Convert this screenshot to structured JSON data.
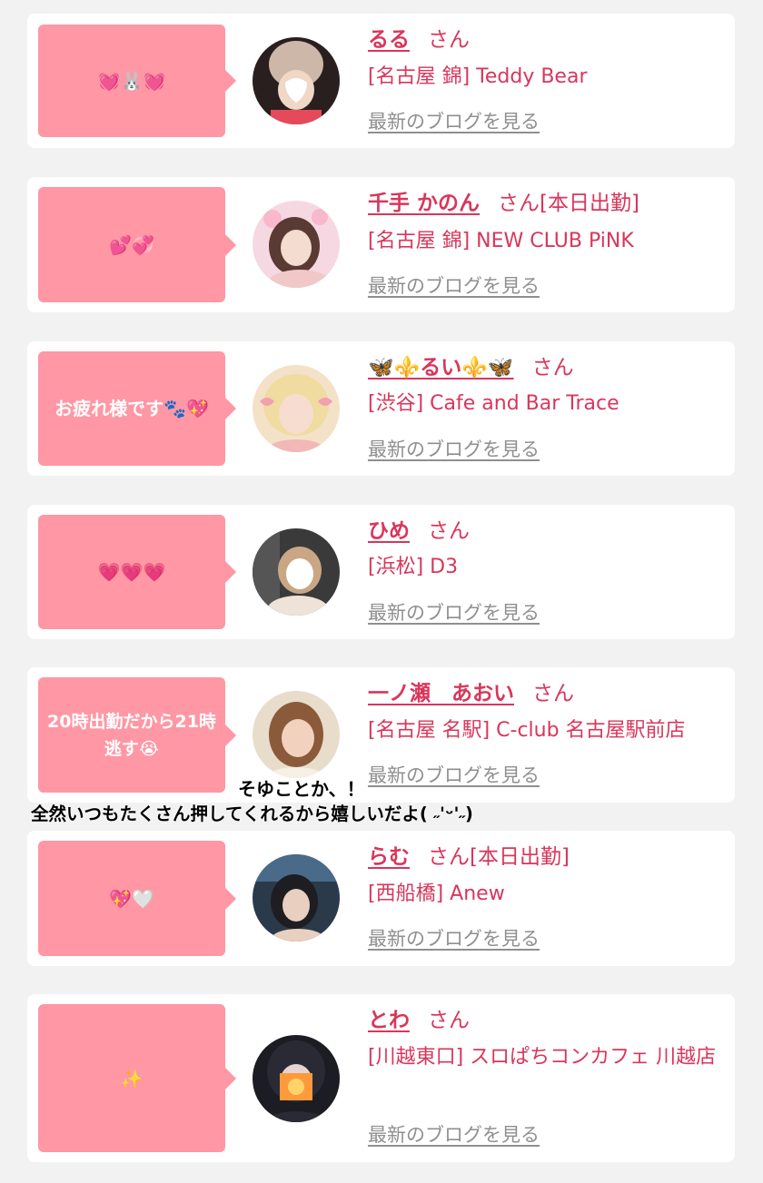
{
  "cards": [
    {
      "message": "💓🐰💓",
      "name": "るる",
      "honorific": "さん",
      "status": "",
      "shop": "[名古屋 錦] Teddy Bear",
      "blog_link": "最新のブログを見る",
      "avatar_colors": [
        "#e8d7c8",
        "#2a1f1f",
        "#d9a48a"
      ]
    },
    {
      "message": "💕💞",
      "name": "千手 かのん",
      "honorific": "さん",
      "status": "[本日出勤]",
      "shop": "[名古屋 錦] NEW CLUB PiNK",
      "blog_link": "最新のブログを見る",
      "avatar_colors": [
        "#f6d8e2",
        "#5a3a33",
        "#f0c8c8"
      ]
    },
    {
      "message": "お疲れ様です🐾💖",
      "name": "🦋⚜️るい⚜️🦋",
      "honorific": "さん",
      "status": "",
      "shop": "[渋谷] Cafe and Bar Trace",
      "blog_link": "最新のブログを見る",
      "avatar_colors": [
        "#f3e2c8",
        "#f0dba0",
        "#f2b8b8"
      ]
    },
    {
      "message": "💗💗💗",
      "name": "ひめ",
      "honorific": "さん",
      "status": "",
      "shop": "[浜松] D3",
      "blog_link": "最新のブログを見る",
      "avatar_colors": [
        "#3a3a3a",
        "#efe3d9",
        "#c9a784"
      ]
    },
    {
      "message": "20時出勤だから21時逃す😭",
      "name": "一ノ瀬　あおい",
      "honorific": "さん",
      "status": "",
      "shop": "[名古屋 名駅] C-club 名古屋駅前店",
      "blog_link": "最新のブログを見る",
      "avatar_colors": [
        "#e8dccb",
        "#8a5a3a",
        "#f2d2bf"
      ]
    },
    {
      "message": "💖🤍",
      "name": "らむ",
      "honorific": "さん",
      "status": "[本日出勤]",
      "shop": "[西船橋] Anew",
      "blog_link": "最新のブログを見る",
      "avatar_colors": [
        "#2a3a4a",
        "#1e1e22",
        "#e9cfc0"
      ]
    },
    {
      "message": "✨",
      "name": "とわ",
      "honorific": "さん",
      "status": "",
      "shop": "[川越東口] スロぱちコンカフェ 川越店",
      "blog_link": "最新のブログを見る",
      "avatar_colors": [
        "#1c1c24",
        "#ff9a3a",
        "#e6d4d0"
      ]
    }
  ],
  "overlay": {
    "line1": "そゆことか、！",
    "line2": "全然いつもたくさん押してくれるから嬉しいだよ( ˶'ᵕ'˶)"
  }
}
